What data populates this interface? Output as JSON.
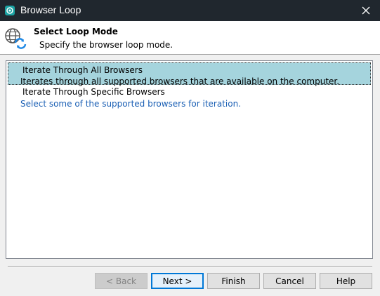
{
  "window": {
    "title": "Browser Loop",
    "close_glyph": "✕"
  },
  "header": {
    "title": "Select Loop Mode",
    "subtitle": "Specify the browser loop mode."
  },
  "list": {
    "items": [
      {
        "title": "Iterate Through All Browsers",
        "description": "Iterates through all supported browsers that are available on the computer.",
        "selected": true
      },
      {
        "title": "Iterate Through Specific Browsers",
        "description": "Select some of the supported browsers for iteration.",
        "selected": false
      }
    ]
  },
  "buttons": {
    "back": "< Back",
    "next": "Next >",
    "finish": "Finish",
    "cancel": "Cancel",
    "help": "Help"
  },
  "colors": {
    "titlebar": "#20272e",
    "selection": "#a5d4dd",
    "link_text": "#1a5fb4",
    "icon_blue": "#1e88e5"
  },
  "icons": {
    "app": "teal-gear-icon",
    "header": "globe-refresh-icon",
    "close": "close-icon"
  }
}
